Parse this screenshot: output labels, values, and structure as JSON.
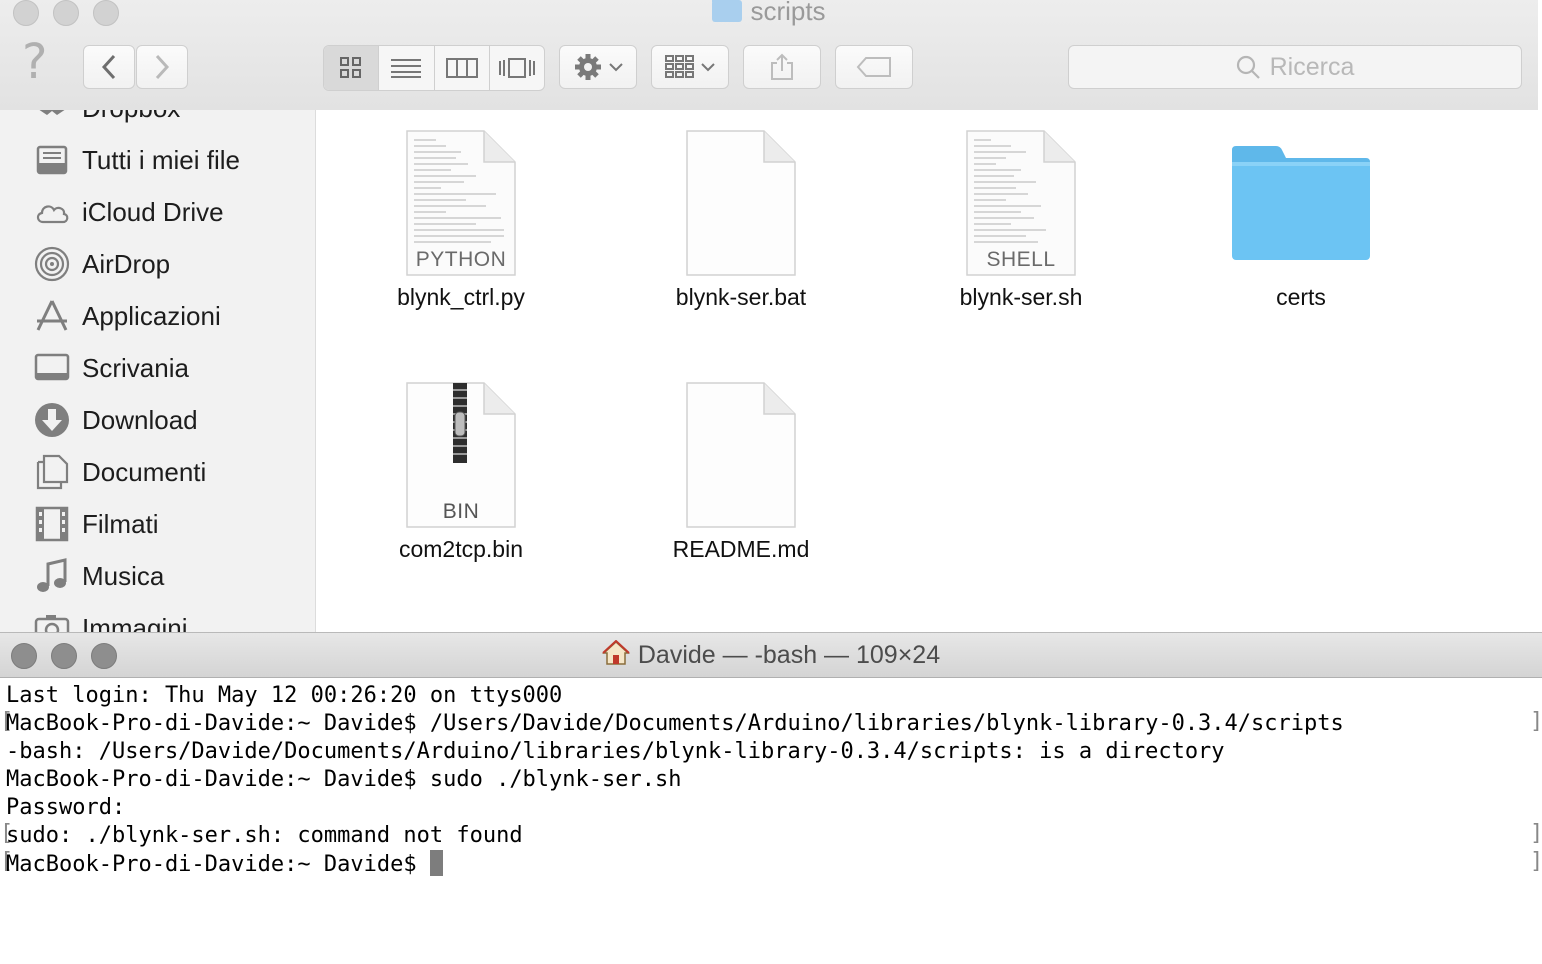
{
  "finder": {
    "title": "scripts",
    "search_placeholder": "Ricerca",
    "sidebar": {
      "items": [
        {
          "label": "Dropbox",
          "icon": "dropbox-icon"
        },
        {
          "label": "Tutti i miei file",
          "icon": "all-files-icon"
        },
        {
          "label": "iCloud Drive",
          "icon": "cloud-icon"
        },
        {
          "label": "AirDrop",
          "icon": "airdrop-icon"
        },
        {
          "label": "Applicazioni",
          "icon": "applications-icon"
        },
        {
          "label": "Scrivania",
          "icon": "desktop-icon"
        },
        {
          "label": "Download",
          "icon": "download-icon"
        },
        {
          "label": "Documenti",
          "icon": "documents-icon"
        },
        {
          "label": "Filmati",
          "icon": "movies-icon"
        },
        {
          "label": "Musica",
          "icon": "music-icon"
        },
        {
          "label": "Immagini",
          "icon": "pictures-icon"
        }
      ]
    },
    "files": [
      {
        "name": "blynk_ctrl.py",
        "kind": "PYTHON"
      },
      {
        "name": "blynk-ser.bat",
        "kind": ""
      },
      {
        "name": "blynk-ser.sh",
        "kind": "SHELL"
      },
      {
        "name": "certs",
        "kind": "folder"
      },
      {
        "name": "com2tcp.bin",
        "kind": "BIN"
      },
      {
        "name": "README.md",
        "kind": ""
      }
    ]
  },
  "terminal": {
    "title": "Davide — -bash — 109×24",
    "lines": [
      "Last login: Thu May 12 00:26:20 on ttys000",
      "MacBook-Pro-di-Davide:~ Davide$ /Users/Davide/Documents/Arduino/libraries/blynk-library-0.3.4/scripts",
      "-bash: /Users/Davide/Documents/Arduino/libraries/blynk-library-0.3.4/scripts: is a directory",
      "MacBook-Pro-di-Davide:~ Davide$ sudo ./blynk-ser.sh",
      "Password:",
      "sudo: ./blynk-ser.sh: command not found",
      "MacBook-Pro-di-Davide:~ Davide$ "
    ]
  },
  "colors": {
    "folder": "#6cc4f3",
    "sidebar_bg": "#f2f2f2",
    "toolbar_bg": "#e6e6e6"
  }
}
